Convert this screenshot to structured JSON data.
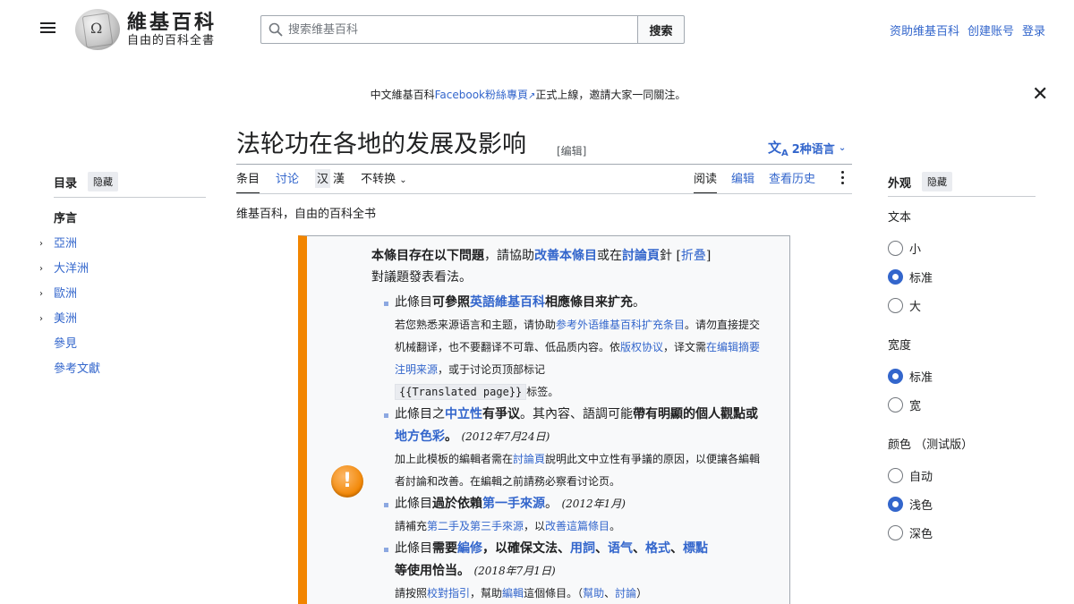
{
  "header": {
    "wordmark_title": "維基百科",
    "wordmark_tagline": "自由的百科全書",
    "search_placeholder": "搜索维基百科",
    "search_button": "搜索",
    "user_links": [
      "资助维基百科",
      "创建账号",
      "登录"
    ]
  },
  "sitenotice": {
    "before": "中文維基百科",
    "link": "Facebook粉絲專頁",
    "after": "正式上線，邀請大家一同關注。",
    "close": "✕"
  },
  "page": {
    "title": "法轮功在各地的发展及影响",
    "edit_label": "[编辑]",
    "languages": "2种语言",
    "tabs_left": [
      "条目",
      "讨论"
    ],
    "variant_simplified": "汉",
    "variant_traditional": "漢",
    "variant_dropdown": "不转换",
    "tabs_right": [
      "阅读",
      "编辑",
      "查看历史"
    ],
    "tagline": "维基百科，自由的百科全书"
  },
  "toc": {
    "title": "目录",
    "hide": "隐藏",
    "items": [
      "序言",
      "亞洲",
      "大洋洲",
      "歐洲",
      "美洲",
      "參見",
      "參考文獻"
    ]
  },
  "appearance": {
    "title": "外观",
    "hide": "隐藏",
    "text_label": "文本",
    "text_options": [
      "小",
      "标准",
      "大"
    ],
    "width_label": "宽度",
    "width_options": [
      "标准",
      "宽"
    ],
    "color_label": "颜色 （测试版）",
    "color_options": [
      "自动",
      "浅色",
      "深色"
    ]
  },
  "ambox": {
    "header_a": "本條目存在以下問題",
    "header_b": "，請協助",
    "header_link1": "改善本條目",
    "header_c": "或在",
    "header_link2": "討論頁",
    "header_d": "針 [",
    "header_link3": "折叠",
    "header_e": "]",
    "header_line2": "對議題發表看法。",
    "issue1_a": "此條目",
    "issue1_b": "可參照",
    "issue1_link": "英語維基百科",
    "issue1_c": "相應條目来扩充",
    "issue1_d": "。",
    "issue1_sub_a": "若您熟悉来源语言和主题，请协助",
    "issue1_sub_link1": "参考外语维基百科扩充条目",
    "issue1_sub_b": "。请勿直接提交机械翻译，也不要翻译不可靠、低品质内容。依",
    "issue1_sub_link2": "版权协议",
    "issue1_sub_c": "，译文需",
    "issue1_sub_link3": "在编辑摘要注明来源",
    "issue1_sub_d": "，或于讨论页顶部标记",
    "issue1_code": "{{Translated page}}",
    "issue1_sub_e": "标签。",
    "issue2_a": "此條目之",
    "issue2_link1": "中立性",
    "issue2_b": "有爭议",
    "issue2_c": "。其內容、語調可能",
    "issue2_d": "帶有明顯的個人觀點或",
    "issue2_link2": "地方色彩",
    "issue2_e": "。",
    "issue2_date": "(2012年7月24日)",
    "issue2_sub_a": "加上此模板的編輯者需在",
    "issue2_sub_link": "討論頁",
    "issue2_sub_b": "說明此文中立性有爭議的原因，以便讓各編輯者討論和改善。在編輯之前請務必察看讨论页。",
    "issue3_a": "此條目",
    "issue3_b": "過於依賴",
    "issue3_link": "第一手來源",
    "issue3_c": "。",
    "issue3_date": "(2012年1月)",
    "issue3_sub_a": "請補充",
    "issue3_sub_link1": "第二手及第三手來源",
    "issue3_sub_b": "，以",
    "issue3_sub_link2": "改善這篇條目",
    "issue3_sub_c": "。",
    "issue4_a": "此條目",
    "issue4_b": "需要",
    "issue4_link1": "編修",
    "issue4_c": "，以確保文法、",
    "issue4_link2": "用詞",
    "issue4_d": "、",
    "issue4_link3": "语气",
    "issue4_e": "、",
    "issue4_link4": "格式",
    "issue4_f": "、",
    "issue4_link5": "標點",
    "issue4_g": "等使用恰当。",
    "issue4_date": "(2018年7月1日)",
    "issue4_sub_a": "請按照",
    "issue4_sub_link1": "校對指引",
    "issue4_sub_b": "，幫助",
    "issue4_sub_link2": "編輯",
    "issue4_sub_c": "這個條目。（",
    "issue4_sub_link3": "幫助",
    "issue4_sub_d": "、",
    "issue4_sub_link4": "討論",
    "issue4_sub_e": "）"
  },
  "colors": {
    "link": "#3366cc",
    "ambox_accent": "#f28500",
    "text": "#202122"
  }
}
